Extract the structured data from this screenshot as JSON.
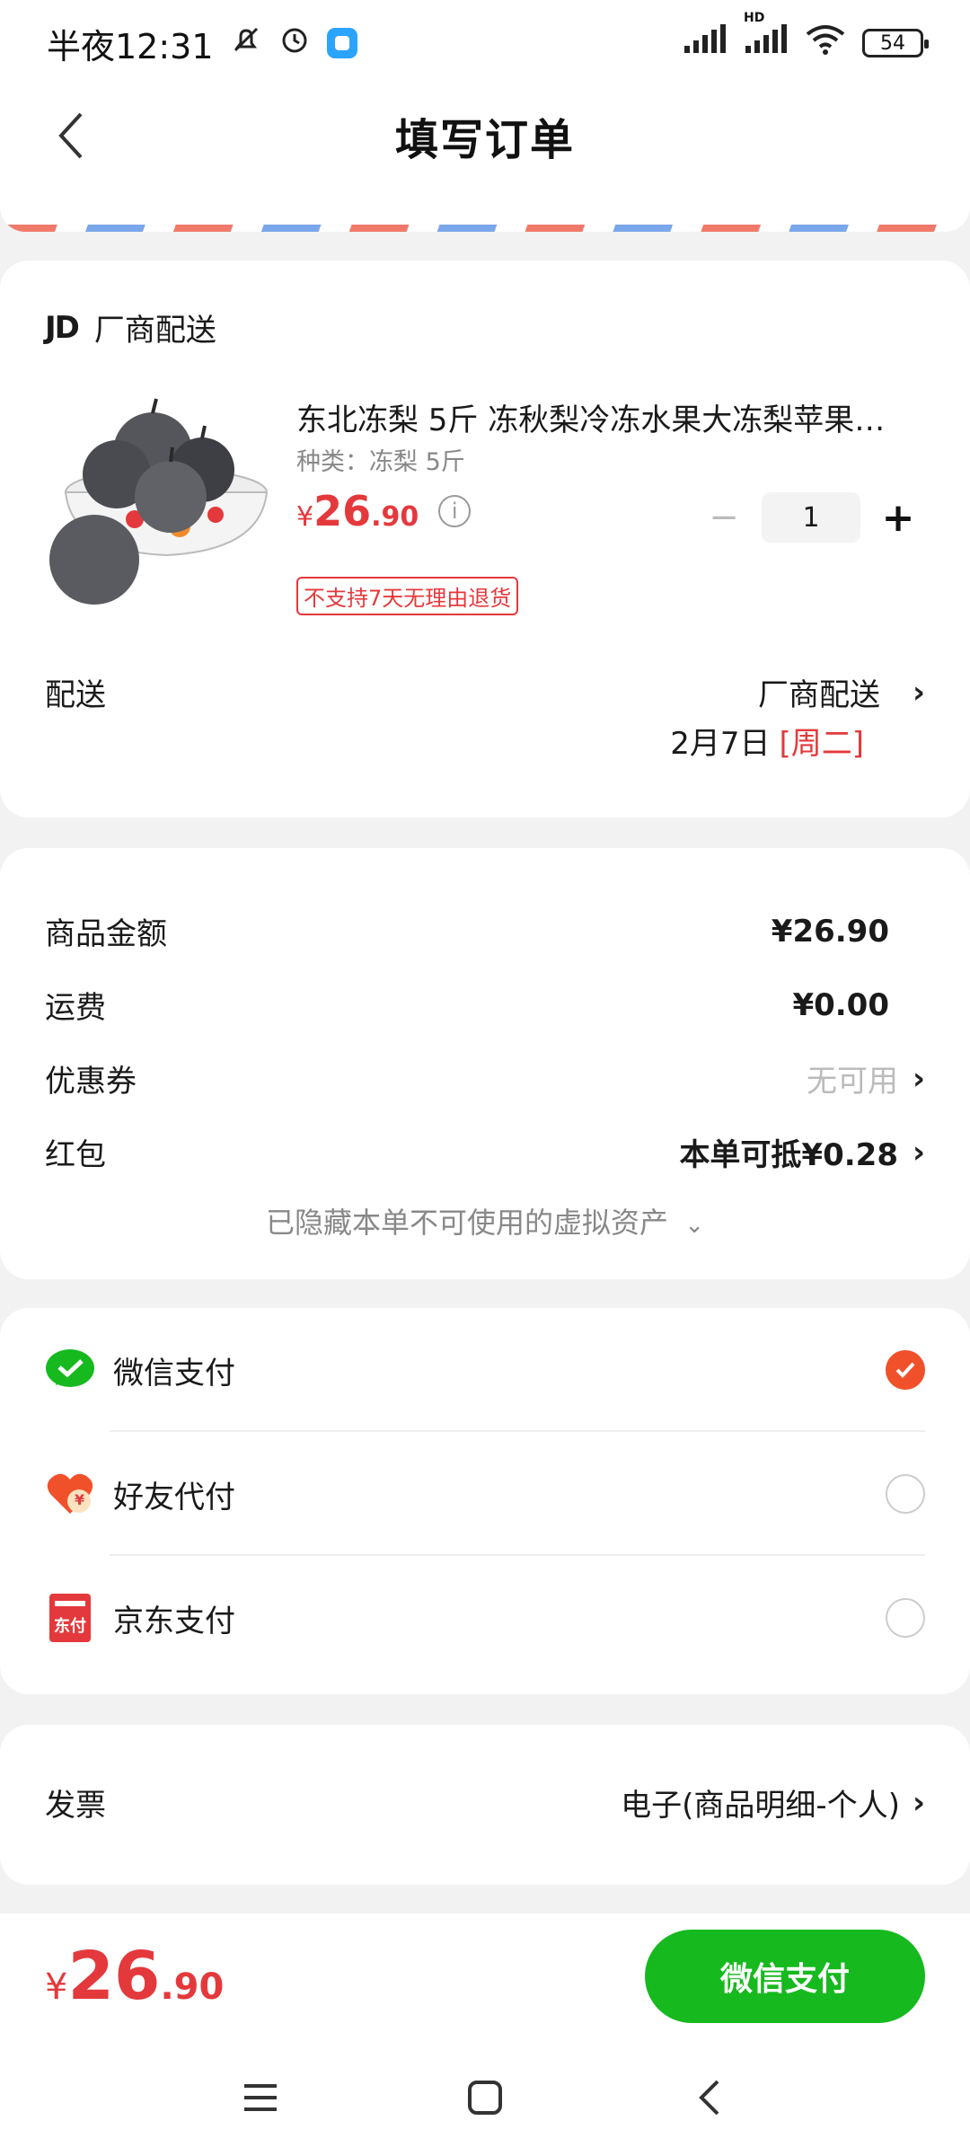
{
  "status_bar": {
    "time": "半夜12:31",
    "battery": "54",
    "network": "HD"
  },
  "header": {
    "title": "填写订单"
  },
  "vendor": {
    "logo": "JD",
    "name": "厂商配送"
  },
  "product": {
    "name": "东北冻梨 5斤 冻秋梨冷冻水果大冻梨苹果…",
    "spec": "种类：冻梨 5斤",
    "price_symbol": "¥",
    "price_int": "26",
    "price_dec": ".90",
    "quantity": "1",
    "tag": "不支持7天无理由退货"
  },
  "delivery": {
    "label": "配送",
    "method": "厂商配送",
    "date": "2月7日",
    "weekday": "[周二]"
  },
  "summary": {
    "rows": [
      {
        "label": "商品金额",
        "value": "¥26.90"
      },
      {
        "label": "运费",
        "value": "¥0.00"
      },
      {
        "label": "优惠券",
        "value": "无可用"
      },
      {
        "label": "红包",
        "value": "本单可抵¥0.28"
      }
    ],
    "hidden_note": "已隐藏本单不可使用的虚拟资产"
  },
  "payment": {
    "options": [
      {
        "label": "微信支付",
        "selected": true
      },
      {
        "label": "好友代付",
        "selected": false
      },
      {
        "label": "京东支付",
        "selected": false
      }
    ],
    "jd_pay_icon_text": "东付",
    "friend_pay_icon_text": "¥"
  },
  "invoice": {
    "label": "发票",
    "value": "电子(商品明细-个人)"
  },
  "bottom": {
    "total_symbol": "¥",
    "total_int": "26",
    "total_dec": ".90",
    "button": "微信支付"
  },
  "colors": {
    "price_red": "#e4393c",
    "wechat_green": "#16b91e",
    "selected_orange": "#f0502a"
  }
}
